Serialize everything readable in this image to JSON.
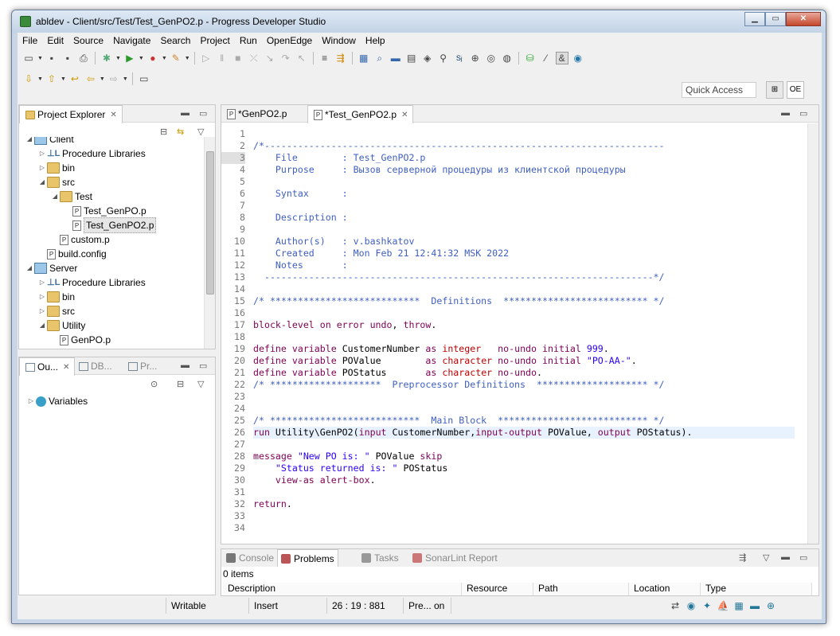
{
  "window": {
    "title": "abldev - Client/src/Test/Test_GenPO2.p - Progress Developer Studio"
  },
  "menu": [
    "File",
    "Edit",
    "Source",
    "Navigate",
    "Search",
    "Project",
    "Run",
    "OpenEdge",
    "Window",
    "Help"
  ],
  "quick_access": "Quick Access",
  "project_explorer": {
    "title": "Project Explorer",
    "items": [
      {
        "label": "Client",
        "type": "project",
        "depth": 0,
        "exp": "open"
      },
      {
        "label": "Procedure Libraries",
        "type": "lib",
        "depth": 1,
        "exp": "closed"
      },
      {
        "label": "bin",
        "type": "folder",
        "depth": 1,
        "exp": "closed"
      },
      {
        "label": "src",
        "type": "folder",
        "depth": 1,
        "exp": "open"
      },
      {
        "label": "Test",
        "type": "folder",
        "depth": 2,
        "exp": "open"
      },
      {
        "label": "Test_GenPO.p",
        "type": "file",
        "depth": 3,
        "exp": ""
      },
      {
        "label": "Test_GenPO2.p",
        "type": "file",
        "depth": 3,
        "exp": "",
        "selected": true
      },
      {
        "label": "custom.p",
        "type": "file",
        "depth": 2,
        "exp": ""
      },
      {
        "label": "build.config",
        "type": "file",
        "depth": 1,
        "exp": ""
      },
      {
        "label": "Server",
        "type": "project",
        "depth": 0,
        "exp": "open"
      },
      {
        "label": "Procedure Libraries",
        "type": "lib",
        "depth": 1,
        "exp": "closed"
      },
      {
        "label": "bin",
        "type": "folder",
        "depth": 1,
        "exp": "closed"
      },
      {
        "label": "src",
        "type": "folder",
        "depth": 1,
        "exp": "closed"
      },
      {
        "label": "Utility",
        "type": "folder",
        "depth": 1,
        "exp": "open"
      },
      {
        "label": "GenPO.p",
        "type": "file",
        "depth": 2,
        "exp": ""
      }
    ]
  },
  "outline": {
    "tabs": [
      "Ou...",
      "DB...",
      "Pr..."
    ],
    "items": [
      {
        "label": "Variables"
      }
    ]
  },
  "editor": {
    "tabs": [
      {
        "label": "*GenPO2.p",
        "active": false
      },
      {
        "label": "*Test_GenPO2.p",
        "active": true
      }
    ],
    "current_line": 26,
    "lines": [
      [],
      [
        [
          "cm",
          "/*------------------------------------------------------------------------"
        ]
      ],
      [
        [
          "cm",
          "    File        : Test_GenPO2.p"
        ]
      ],
      [
        [
          "cm",
          "    Purpose     : Вызов серверной процедуры из клиентской процедуры"
        ]
      ],
      [],
      [
        [
          "cm",
          "    Syntax      :"
        ]
      ],
      [],
      [
        [
          "cm",
          "    Description :"
        ]
      ],
      [],
      [
        [
          "cm",
          "    Author(s)   : v.bashkatov"
        ]
      ],
      [
        [
          "cm",
          "    Created     : Mon Feb 21 12:41:32 MSK 2022"
        ]
      ],
      [
        [
          "cm",
          "    Notes       :"
        ]
      ],
      [
        [
          "cm",
          "  ----------------------------------------------------------------------*/"
        ]
      ],
      [],
      [
        [
          "cm",
          "/* ***************************  Definitions  ************************** */"
        ]
      ],
      [],
      [
        [
          "kw",
          "block-level on error undo"
        ],
        [
          "pl",
          ", "
        ],
        [
          "kw",
          "throw"
        ],
        [
          "pl",
          "."
        ]
      ],
      [],
      [
        [
          "kw",
          "define variable "
        ],
        [
          "pl",
          "CustomerNumber "
        ],
        [
          "kw",
          "as "
        ],
        [
          "ty",
          "integer"
        ],
        [
          "kw",
          "   no-undo initial "
        ],
        [
          "nu",
          "999"
        ],
        [
          "pl",
          "."
        ]
      ],
      [
        [
          "kw",
          "define variable "
        ],
        [
          "pl",
          "POValue        "
        ],
        [
          "kw",
          "as "
        ],
        [
          "ty",
          "character"
        ],
        [
          "kw",
          " no-undo initial "
        ],
        [
          "st",
          "\"PO-AA-\""
        ],
        [
          "pl",
          "."
        ]
      ],
      [
        [
          "kw",
          "define variable "
        ],
        [
          "pl",
          "POStatus       "
        ],
        [
          "kw",
          "as "
        ],
        [
          "ty",
          "character"
        ],
        [
          "kw",
          " no-undo"
        ],
        [
          "pl",
          "."
        ]
      ],
      [
        [
          "cm",
          "/* ********************  Preprocessor Definitions  ******************** */"
        ]
      ],
      [],
      [],
      [
        [
          "cm",
          "/* ***************************  Main Block  *************************** */"
        ]
      ],
      [
        [
          "kw",
          "run "
        ],
        [
          "pl",
          "Utility\\GenPO2("
        ],
        [
          "kw",
          "input "
        ],
        [
          "pl",
          "CustomerNumber,"
        ],
        [
          "kw",
          "input-output "
        ],
        [
          "pl",
          "POValue, "
        ],
        [
          "kw",
          "output "
        ],
        [
          "pl",
          "POStatus)."
        ]
      ],
      [],
      [
        [
          "kw",
          "message "
        ],
        [
          "st",
          "\"New PO is: \""
        ],
        [
          "pl",
          " POValue "
        ],
        [
          "kw",
          "skip"
        ]
      ],
      [
        [
          "pl",
          "    "
        ],
        [
          "st",
          "\"Status returned is: \""
        ],
        [
          "pl",
          " POStatus"
        ]
      ],
      [
        [
          "kw",
          "    view-as alert-box"
        ],
        [
          "pl",
          "."
        ]
      ],
      [],
      [
        [
          "kw",
          "return"
        ],
        [
          "pl",
          "."
        ]
      ],
      [],
      []
    ]
  },
  "bottom": {
    "tabs": [
      {
        "label": "Console",
        "active": false
      },
      {
        "label": "Problems",
        "active": true
      },
      {
        "label": "Tasks",
        "active": false
      },
      {
        "label": "SonarLint Report",
        "active": false
      }
    ],
    "items_count": "0 items",
    "columns": [
      "Description",
      "Resource",
      "Path",
      "Location",
      "Type"
    ]
  },
  "status": {
    "writable": "Writable",
    "insert": "Insert",
    "position": "26 : 19 : 881",
    "pre": "Pre... on"
  },
  "colors": {
    "comment": "#3f5fbf",
    "keyword": "#7f0055",
    "type": "#c00000",
    "string": "#2a00ff"
  }
}
